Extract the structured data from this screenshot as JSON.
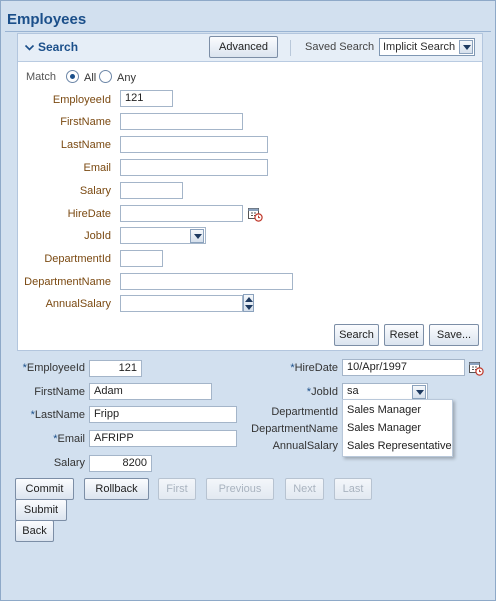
{
  "page": {
    "title": "Employees"
  },
  "search": {
    "title": "Search",
    "advanced_label": "Advanced",
    "saved_search_label": "Saved Search",
    "saved_search_value": "Implicit Search",
    "match_label": "Match",
    "match_all": "All",
    "match_any": "Any",
    "match_selected": "All",
    "fields": [
      {
        "label": "EmployeeId",
        "value": "121"
      },
      {
        "label": "FirstName",
        "value": ""
      },
      {
        "label": "LastName",
        "value": ""
      },
      {
        "label": "Email",
        "value": ""
      },
      {
        "label": "Salary",
        "value": ""
      },
      {
        "label": "HireDate",
        "value": ""
      },
      {
        "label": "JobId",
        "value": ""
      },
      {
        "label": "DepartmentId",
        "value": ""
      },
      {
        "label": "DepartmentName",
        "value": ""
      },
      {
        "label": "AnnualSalary",
        "value": ""
      }
    ],
    "search_button": "Search",
    "reset_button": "Reset",
    "save_button": "Save..."
  },
  "detail": {
    "employee_id_label": "EmployeeId",
    "employee_id_value": "121",
    "first_name_label": "FirstName",
    "first_name_value": "Adam",
    "last_name_label": "LastName",
    "last_name_value": "Fripp",
    "email_label": "Email",
    "email_value": "AFRIPP",
    "salary_label": "Salary",
    "salary_value": "8200",
    "hire_date_label": "HireDate",
    "hire_date_value": "10/Apr/1997",
    "job_id_label": "JobId",
    "job_id_value": "sa",
    "department_id_label": "DepartmentId",
    "department_name_label": "DepartmentName",
    "annual_salary_label": "AnnualSalary",
    "required_marker": "*"
  },
  "job_suggestions": [
    "Sales Manager",
    "Sales Manager",
    "Sales Representative"
  ],
  "actions": {
    "commit": "Commit",
    "rollback": "Rollback",
    "first": "First",
    "previous": "Previous",
    "next": "Next",
    "last": "Last",
    "submit": "Submit",
    "back": "Back"
  },
  "icons": {
    "collapse": "chevron-down-icon",
    "calendar": "calendar-icon",
    "dropdown": "dropdown-arrow-icon",
    "spinner": "number-spinner-icon"
  }
}
